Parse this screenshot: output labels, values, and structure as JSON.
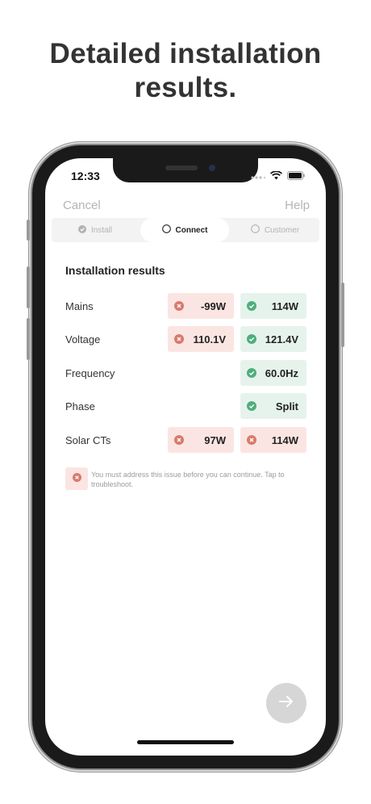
{
  "headline": {
    "line1": "Detailed installation",
    "line2": "results."
  },
  "status_bar": {
    "time": "12:33",
    "icons": [
      "signal-dots-icon",
      "wifi-icon",
      "battery-icon"
    ]
  },
  "nav": {
    "cancel": "Cancel",
    "help": "Help"
  },
  "stepper": {
    "steps": [
      {
        "label": "Install",
        "state": "done",
        "icon": "check-circle-icon"
      },
      {
        "label": "Connect",
        "state": "active",
        "icon": "circle-outline-icon"
      },
      {
        "label": "Customer",
        "state": "pending",
        "icon": "circle-outline-icon"
      }
    ]
  },
  "results": {
    "title": "Installation results",
    "rows": [
      {
        "label": "Mains",
        "left": {
          "value": "-99W",
          "status": "error"
        },
        "right": {
          "value": "114W",
          "status": "ok"
        }
      },
      {
        "label": "Voltage",
        "left": {
          "value": "110.1V",
          "status": "error"
        },
        "right": {
          "value": "121.4V",
          "status": "ok"
        }
      },
      {
        "label": "Frequency",
        "left": null,
        "right": {
          "value": "60.0Hz",
          "status": "ok"
        }
      },
      {
        "label": "Phase",
        "left": null,
        "right": {
          "value": "Split",
          "status": "ok"
        }
      },
      {
        "label": "Solar CTs",
        "left": {
          "value": "97W",
          "status": "error"
        },
        "right": {
          "value": "114W",
          "status": "error"
        }
      }
    ]
  },
  "notice": {
    "text": "You must address this issue before you can continue. Tap to troubleshoot.",
    "icon": "error-circle-icon"
  },
  "next_button": {
    "icon": "arrow-right-icon"
  },
  "colors": {
    "error_bg": "#fbe5e2",
    "error_icon": "#d97a6c",
    "ok_bg": "#e6f3ec",
    "ok_icon": "#4fae7d",
    "next_button_bg": "#d6d6d6"
  }
}
